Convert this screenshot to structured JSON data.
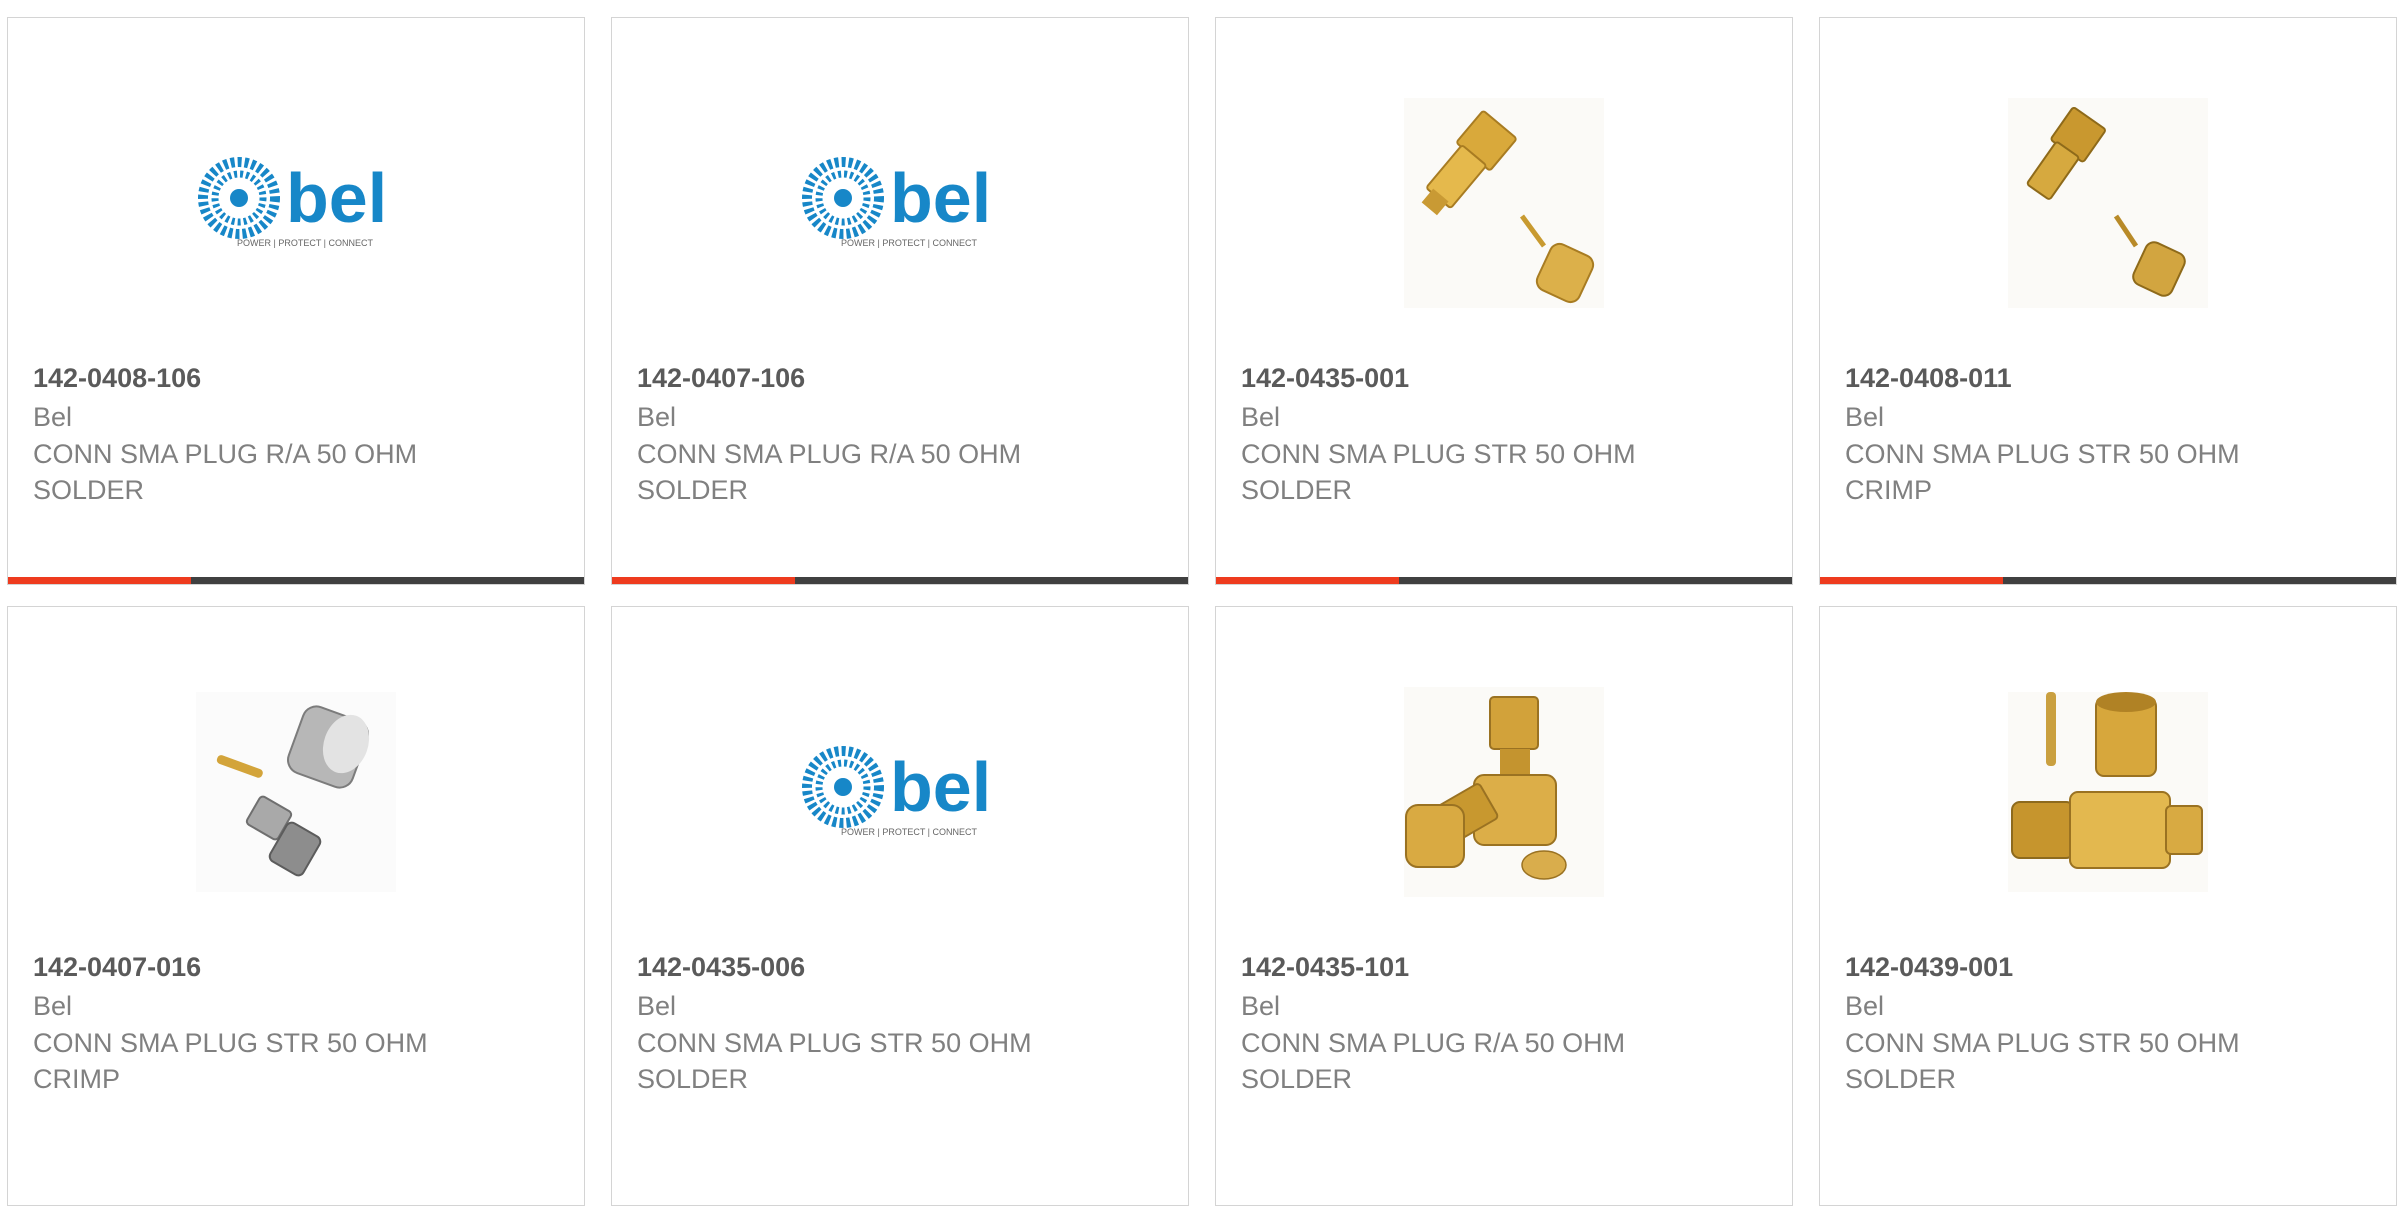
{
  "colors": {
    "accent_bar": "#ee3b1e",
    "dark_bar": "#404040",
    "bel_blue": "#1787c8"
  },
  "products": [
    {
      "part_number": "142-0408-106",
      "manufacturer": "Bel",
      "description": "CONN SMA PLUG R/A 50 OHM SOLDER",
      "image": "bel-logo",
      "logo": {
        "word": "bel",
        "tagline": "POWER | PROTECT | CONNECT"
      }
    },
    {
      "part_number": "142-0407-106",
      "manufacturer": "Bel",
      "description": "CONN SMA PLUG R/A 50 OHM SOLDER",
      "image": "bel-logo",
      "logo": {
        "word": "bel",
        "tagline": "POWER | PROTECT | CONNECT"
      }
    },
    {
      "part_number": "142-0435-001",
      "manufacturer": "Bel",
      "description": "CONN SMA PLUG STR 50 OHM SOLDER",
      "image": "gold-sma-straight-plug-kit"
    },
    {
      "part_number": "142-0408-011",
      "manufacturer": "Bel",
      "description": "CONN SMA PLUG STR 50 OHM CRIMP",
      "image": "gold-sma-straight-plug-kit"
    },
    {
      "part_number": "142-0407-016",
      "manufacturer": "Bel",
      "description": "CONN SMA PLUG STR 50 OHM CRIMP",
      "image": "silver-sma-crimp-plug-kit"
    },
    {
      "part_number": "142-0435-006",
      "manufacturer": "Bel",
      "description": "CONN SMA PLUG STR 50 OHM SOLDER",
      "image": "bel-logo",
      "logo": {
        "word": "bel",
        "tagline": "POWER | PROTECT | CONNECT"
      }
    },
    {
      "part_number": "142-0435-101",
      "manufacturer": "Bel",
      "description": "CONN SMA PLUG R/A 50 OHM SOLDER",
      "image": "gold-sma-right-angle-plug-kit"
    },
    {
      "part_number": "142-0439-001",
      "manufacturer": "Bel",
      "description": "CONN SMA PLUG STR 50 OHM SOLDER",
      "image": "gold-sma-straight-plug-kit"
    }
  ]
}
